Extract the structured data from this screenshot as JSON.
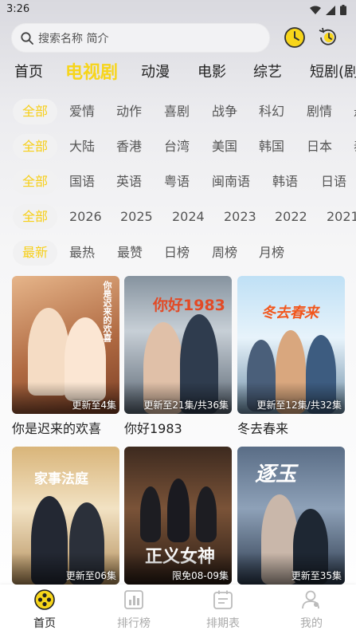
{
  "status": {
    "time": "3:26"
  },
  "search": {
    "placeholder": "搜索名称 简介"
  },
  "tabs": [
    "首页",
    "电视剧",
    "动漫",
    "电影",
    "综艺",
    "短剧(剧"
  ],
  "filters": {
    "genre": [
      "全部",
      "爱情",
      "动作",
      "喜剧",
      "战争",
      "科幻",
      "剧情",
      "悬"
    ],
    "region": [
      "全部",
      "大陆",
      "香港",
      "台湾",
      "美国",
      "韩国",
      "日本",
      "泰"
    ],
    "language": [
      "全部",
      "国语",
      "英语",
      "粤语",
      "闽南语",
      "韩语",
      "日语",
      "其"
    ],
    "year": [
      "全部",
      "2026",
      "2025",
      "2024",
      "2023",
      "2022",
      "2021"
    ],
    "sort": [
      "最新",
      "最热",
      "最赞",
      "日榜",
      "周榜",
      "月榜"
    ]
  },
  "posters": [
    {
      "title": "你是迟来的欢喜",
      "badge": "更新至4集",
      "art": "你是迟来的欢喜",
      "colors": [
        "#c98a5f",
        "#f0c79a",
        "#8b4a2d"
      ]
    },
    {
      "title": "你好1983",
      "badge": "更新至21集/共36集",
      "art": "你好1983",
      "colors": [
        "#5d6b7a",
        "#a7b2be",
        "#c94b2d"
      ]
    },
    {
      "title": "冬去春来",
      "badge": "更新至12集/共32集",
      "art": "冬去春来",
      "colors": [
        "#7fb3d9",
        "#d7ecf8",
        "#3d6d8f"
      ]
    },
    {
      "title": "",
      "badge": "更新至06集",
      "art": "家事法庭",
      "colors": [
        "#c8a46a",
        "#e9d7b2",
        "#2f2f36"
      ]
    },
    {
      "title": "",
      "badge": "限免08-09集",
      "art": "正义女神",
      "colors": [
        "#5a3c2b",
        "#a77b58",
        "#2b1d16"
      ]
    },
    {
      "title": "",
      "badge": "更新至35集",
      "art": "逐玉",
      "colors": [
        "#4c5d74",
        "#9fb0c4",
        "#1f2a38"
      ]
    }
  ],
  "nav": [
    "首页",
    "排行榜",
    "排期表",
    "我的"
  ],
  "colors": {
    "accent": "#f7d51a",
    "inactive_nav": "#aaaaaa"
  }
}
